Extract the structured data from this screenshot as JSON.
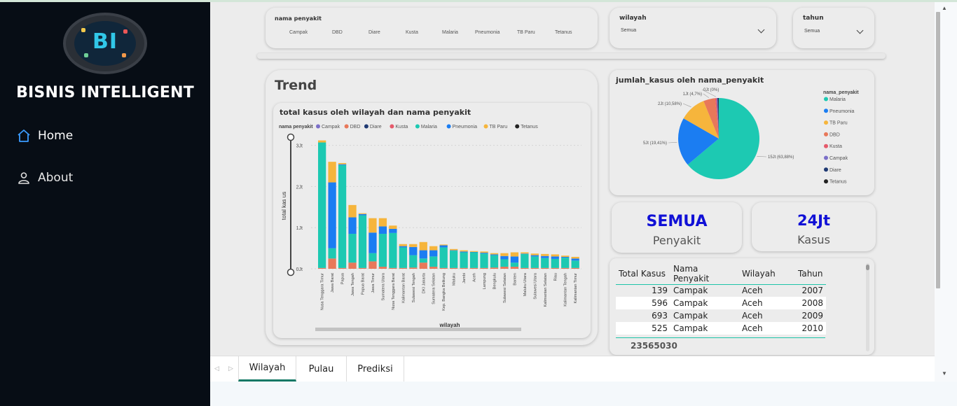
{
  "sidebar": {
    "logo_text": "BI",
    "brand": "BISNIS INTELLIGENT",
    "nav": [
      {
        "label": "Home",
        "icon": "home-icon"
      },
      {
        "label": "About",
        "icon": "user-icon"
      }
    ]
  },
  "slicers": {
    "penyakit": {
      "title": "nama penyakit",
      "options": [
        "Campak",
        "DBD",
        "Diare",
        "Kusta",
        "Malaria",
        "Pneumonia",
        "TB Paru",
        "Tetanus"
      ]
    },
    "wilayah": {
      "title": "wilayah",
      "value": "Semua"
    },
    "tahun": {
      "title": "tahun",
      "value": "Semua"
    }
  },
  "trend": {
    "title": "Trend"
  },
  "colors": {
    "Campak": "#7b6fc8",
    "DBD": "#e8785a",
    "Diare": "#1f3a73",
    "Kusta": "#e55a6b",
    "Malaria": "#1dc9b2",
    "Pneumonia": "#1b7df2",
    "TB Paru": "#f6b53c",
    "Tetanus": "#222222"
  },
  "chart_data": [
    {
      "type": "bar",
      "stacked": true,
      "title": "total kasus oleh wilayah dan nama penyakit",
      "legend_title": "nama penyakit",
      "xlabel": "wilayah",
      "ylabel": "total kas us",
      "yticks": [
        "0Jt",
        "1Jt",
        "2Jt",
        "3Jt"
      ],
      "ylim": [
        0,
        3.3
      ],
      "legend": [
        "Campak",
        "DBD",
        "Diare",
        "Kusta",
        "Malaria",
        "Pneumonia",
        "TB Paru",
        "Tetanus"
      ],
      "categories": [
        "Nusa Tenggara Timur",
        "Jawa Barat",
        "Papua",
        "Jawa Tengah",
        "Papua Barat",
        "Jawa Timur",
        "Sumatera Utara",
        "Nusa Tenggara Barat",
        "Kalimantan Barat",
        "Sulawesi Tengah",
        "DKI Jakarta",
        "Sumatera Selatan",
        "Kep. Bangka Belitung",
        "Maluku",
        "Jambi",
        "Aceh",
        "Lampung",
        "Bengkulu",
        "Sulawesi Selatan",
        "Banten",
        "Maluku Utara",
        "Sulawesi Utara",
        "Kalimantan Selatan",
        "Riau",
        "Kalimantan Tengah",
        "Kalimantan Timur"
      ],
      "series": [
        {
          "name": "DBD",
          "values": [
            0.02,
            0.25,
            0.02,
            0.15,
            0.02,
            0.18,
            0.05,
            0.02,
            0.02,
            0.03,
            0.15,
            0.05,
            0.02,
            0.02,
            0.02,
            0.02,
            0.02,
            0.03,
            0.05,
            0.05,
            0.02,
            0.02,
            0.02,
            0.02,
            0.02,
            0.02
          ]
        },
        {
          "name": "Malaria",
          "values": [
            3.05,
            0.25,
            2.5,
            0.7,
            1.28,
            0.2,
            0.8,
            0.85,
            0.5,
            0.3,
            0.1,
            0.25,
            0.5,
            0.42,
            0.38,
            0.38,
            0.35,
            0.3,
            0.18,
            0.1,
            0.34,
            0.28,
            0.24,
            0.22,
            0.25,
            0.18
          ]
        },
        {
          "name": "Pneumonia",
          "values": [
            0.0,
            1.6,
            0.02,
            0.4,
            0.03,
            0.5,
            0.18,
            0.1,
            0.03,
            0.2,
            0.2,
            0.15,
            0.05,
            0.01,
            0.02,
            0.01,
            0.02,
            0.02,
            0.08,
            0.15,
            0.01,
            0.03,
            0.05,
            0.06,
            0.02,
            0.05
          ]
        },
        {
          "name": "TB Paru",
          "values": [
            0.05,
            0.5,
            0.03,
            0.3,
            0.02,
            0.35,
            0.2,
            0.08,
            0.05,
            0.07,
            0.2,
            0.1,
            0.02,
            0.03,
            0.03,
            0.02,
            0.03,
            0.03,
            0.07,
            0.1,
            0.03,
            0.04,
            0.05,
            0.05,
            0.03,
            0.04
          ]
        }
      ]
    },
    {
      "type": "pie",
      "title": "jumlah_kasus oleh nama_penyakit",
      "legend_title": "nama_penyakit",
      "legend": [
        "Malaria",
        "Pneumonia",
        "TB Paru",
        "DBD",
        "Kusta",
        "Campak",
        "Diare",
        "Tetanus"
      ],
      "slices": [
        {
          "name": "Malaria",
          "value": 63.88,
          "label": "15Jt (63,88%)"
        },
        {
          "name": "Pneumonia",
          "value": 19.41,
          "label": "5Jt (19,41%)"
        },
        {
          "name": "TB Paru",
          "value": 10.58,
          "label": "2Jt (10,58%)"
        },
        {
          "name": "DBD",
          "value": 4.7,
          "label": "1Jt (4,7%)"
        },
        {
          "name": "Kusta",
          "value": 0.6,
          "label": "0Jt (0%)"
        },
        {
          "name": "Campak",
          "value": 0.3,
          "label": ""
        },
        {
          "name": "Diare",
          "value": 0.4,
          "label": ""
        },
        {
          "name": "Tetanus",
          "value": 0.13,
          "label": ""
        }
      ]
    }
  ],
  "kpi": [
    {
      "value": "SEMUA",
      "label": "Penyakit"
    },
    {
      "value": "24Jt",
      "label": "Kasus"
    }
  ],
  "table": {
    "headers": [
      "Total Kasus",
      "Nama Penyakit",
      "Wilayah",
      "Tahun"
    ],
    "rows": [
      [
        "139",
        "Campak",
        "Aceh",
        "2007"
      ],
      [
        "596",
        "Campak",
        "Aceh",
        "2008"
      ],
      [
        "693",
        "Campak",
        "Aceh",
        "2009"
      ],
      [
        "525",
        "Campak",
        "Aceh",
        "2010"
      ]
    ],
    "total": "23565030"
  },
  "tabs": [
    "Wilayah",
    "Pulau",
    "Prediksi"
  ]
}
